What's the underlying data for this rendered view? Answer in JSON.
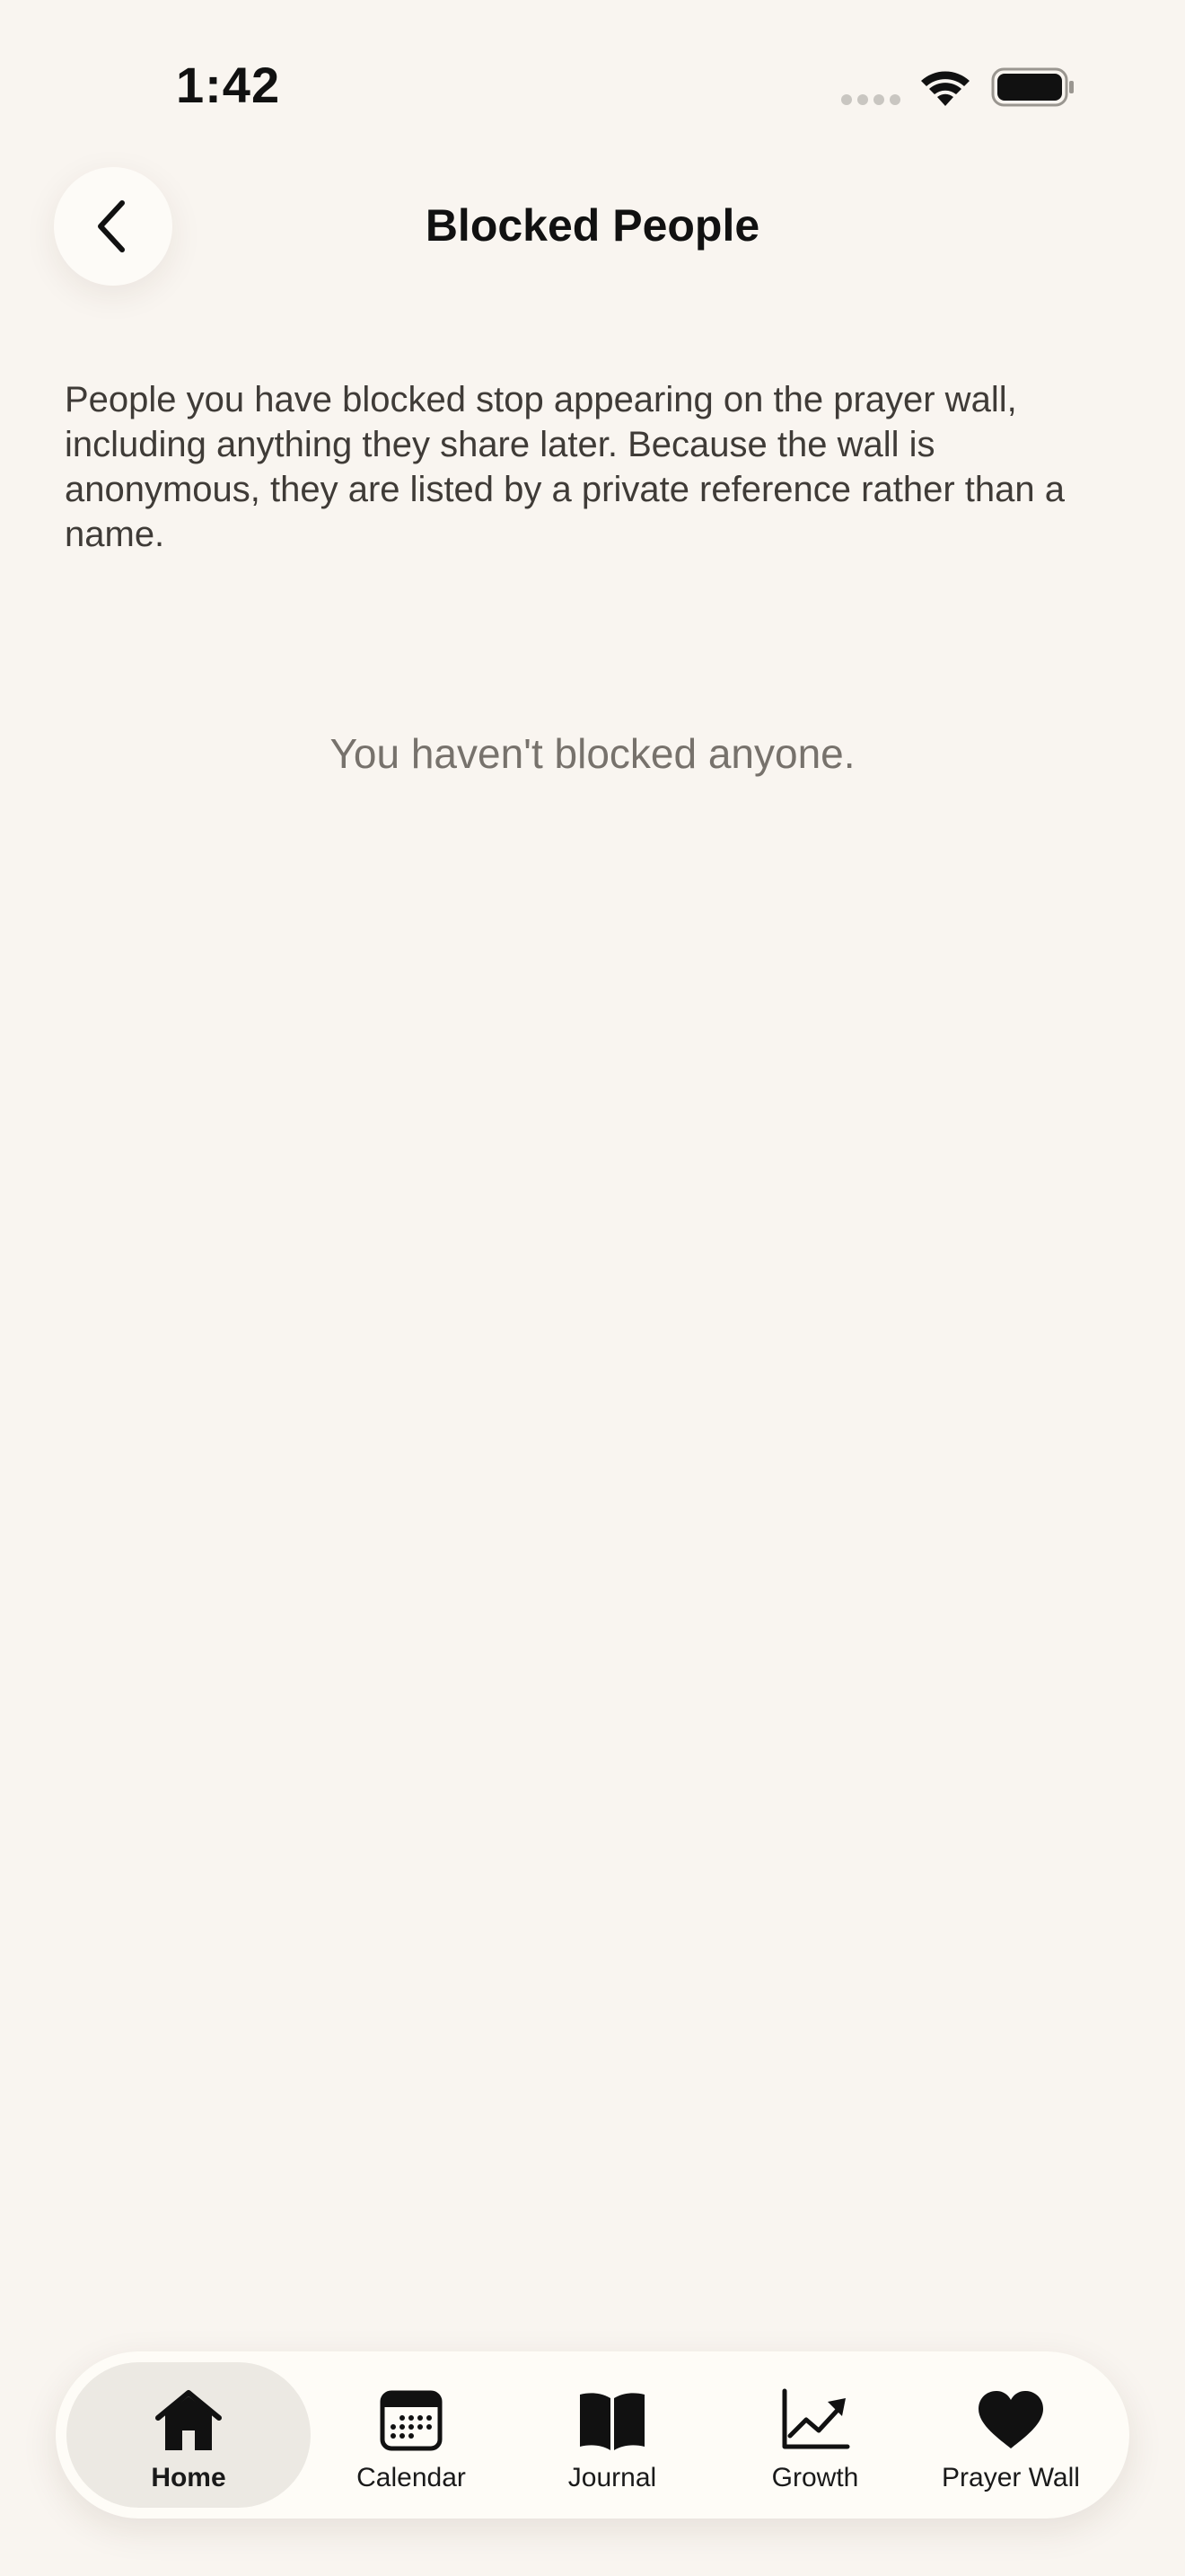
{
  "status_bar": {
    "time": "1:42",
    "icons": [
      "cellular-dots-icon",
      "wifi-icon",
      "battery-icon"
    ]
  },
  "header": {
    "title": "Blocked People",
    "back_icon": "chevron-left-icon"
  },
  "main": {
    "description": "People you have blocked stop appearing on the prayer wall, including anything they share later. Because the wall is anonymous, they are listed by a private reference rather than a name.",
    "empty_message": "You haven't blocked anyone."
  },
  "tab_bar": {
    "active": "Home",
    "tabs": [
      {
        "label": "Home",
        "icon": "home-icon"
      },
      {
        "label": "Calendar",
        "icon": "calendar-icon"
      },
      {
        "label": "Journal",
        "icon": "book-icon"
      },
      {
        "label": "Growth",
        "icon": "chart-line-icon"
      },
      {
        "label": "Prayer Wall",
        "icon": "heart-icon"
      }
    ]
  },
  "colors": {
    "background": "#f9f5f0",
    "tab_bar_background": "#fefcf7",
    "active_tab_background": "#ece9e3",
    "body_text": "#3f3b37",
    "muted_text": "#77726c",
    "title_text": "#111111"
  }
}
